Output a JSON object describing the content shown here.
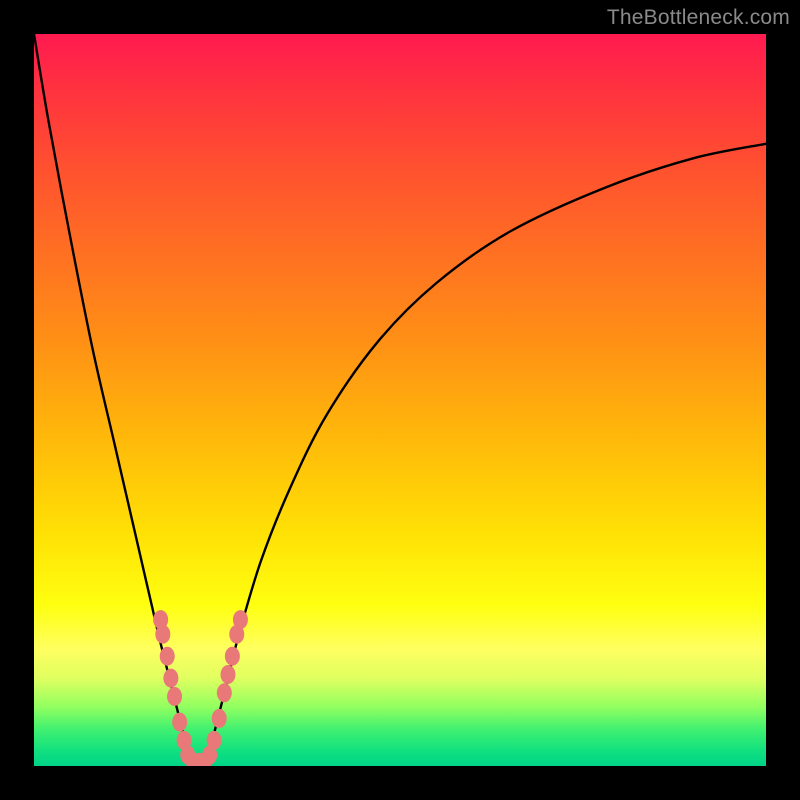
{
  "watermark": "TheBottleneck.com",
  "colors": {
    "frame": "#000000",
    "curve_stroke": "#000000",
    "marker_fill": "#e97878",
    "marker_stroke": "#c95050",
    "gradient_top": "#ff1a50",
    "gradient_bottom": "#00d388"
  },
  "chart_data": {
    "type": "line",
    "title": "",
    "xlabel": "",
    "ylabel": "",
    "xlim": [
      0,
      100
    ],
    "ylim": [
      0,
      100
    ],
    "grid": false,
    "legend": false,
    "series": [
      {
        "name": "left-branch",
        "x": [
          0,
          2,
          5,
          8,
          11,
          14,
          17,
          18.5,
          20,
          20.8,
          21.6
        ],
        "y": [
          100,
          88,
          72,
          57,
          44,
          31,
          18,
          12,
          6,
          3,
          0.5
        ]
      },
      {
        "name": "right-branch",
        "x": [
          23.4,
          24.2,
          25,
          26.5,
          28,
          31,
          35,
          40,
          47,
          55,
          65,
          78,
          90,
          100
        ],
        "y": [
          0.5,
          3,
          6,
          12,
          18,
          28,
          38,
          48,
          58,
          66,
          73,
          79,
          83,
          85
        ]
      }
    ],
    "markers": {
      "name": "highlight-points",
      "points": [
        {
          "x": 17.3,
          "y": 20
        },
        {
          "x": 17.6,
          "y": 18
        },
        {
          "x": 18.2,
          "y": 15
        },
        {
          "x": 18.7,
          "y": 12
        },
        {
          "x": 19.2,
          "y": 9.5
        },
        {
          "x": 19.9,
          "y": 6
        },
        {
          "x": 20.5,
          "y": 3.5
        },
        {
          "x": 21.0,
          "y": 1.5
        },
        {
          "x": 21.8,
          "y": 0.5
        },
        {
          "x": 22.5,
          "y": 0.5
        },
        {
          "x": 23.2,
          "y": 0.5
        },
        {
          "x": 24.0,
          "y": 1.5
        },
        {
          "x": 24.6,
          "y": 3.5
        },
        {
          "x": 25.3,
          "y": 6.5
        },
        {
          "x": 26.0,
          "y": 10
        },
        {
          "x": 26.5,
          "y": 12.5
        },
        {
          "x": 27.1,
          "y": 15
        },
        {
          "x": 27.7,
          "y": 18
        },
        {
          "x": 28.2,
          "y": 20
        }
      ]
    }
  }
}
